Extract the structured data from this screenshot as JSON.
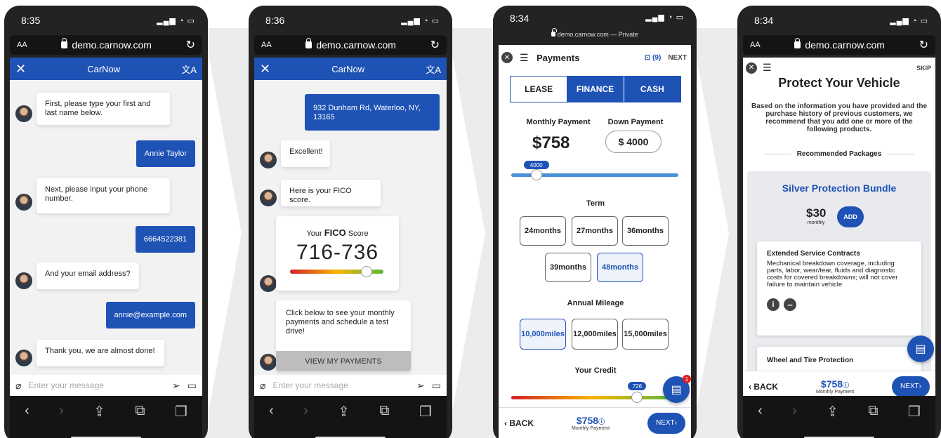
{
  "colors": {
    "brand": "#1f52b5",
    "background": "#ffffff",
    "chevron": "#ececec"
  },
  "phones": [
    {
      "time": "8:35",
      "url": "demo.carnow.com"
    },
    {
      "time": "8:36",
      "url": "demo.carnow.com"
    },
    {
      "time": "8:34",
      "url": "demo.carnow.com — Private"
    },
    {
      "time": "8:34",
      "url": "demo.carnow.com"
    }
  ],
  "browser": {
    "text_size_label": "AA"
  },
  "chat": {
    "app_title": "CarNow",
    "input_placeholder": "Enter your message",
    "screen1": {
      "bot1": "First, please type your first and last name below.",
      "user1": "Annie Taylor",
      "bot2": "Next, please input your phone number.",
      "user2": "6664522381",
      "bot3": "And your email address?",
      "user3": "annie@example.com",
      "bot4": "Thank you, we are almost done!"
    },
    "screen2": {
      "user_address": "932 Dunham Rd, Waterloo, NY, 13165",
      "bot1": "Excellent!",
      "bot2": "Here is your FICO score.",
      "fico_prefix": "Your",
      "fico_brand": "FICO",
      "fico_suffix": "Score",
      "fico_score": "716-736",
      "fico_position": 0.82,
      "cta_text": "Click below to see your monthly payments and schedule a test drive!",
      "cta_button": "VIEW MY PAYMENTS"
    }
  },
  "payments": {
    "title": "Payments",
    "saved_count": "(9)",
    "next_label": "NEXT",
    "tabs": [
      "LEASE",
      "FINANCE",
      "CASH"
    ],
    "monthly_label": "Monthly Payment",
    "monthly_value": "$758",
    "down_label": "Down Payment",
    "down_value": "$ 4000",
    "slider_value": "4000",
    "slider_fraction": 0.15,
    "term_label": "Term",
    "terms": [
      {
        "n": "24",
        "u": "months"
      },
      {
        "n": "27",
        "u": "months"
      },
      {
        "n": "36",
        "u": "months"
      },
      {
        "n": "39",
        "u": "months"
      },
      {
        "n": "48",
        "u": "months"
      }
    ],
    "mileage_label": "Annual Mileage",
    "mileages": [
      {
        "n": "10,000",
        "u": "miles"
      },
      {
        "n": "12,000",
        "u": "miles"
      },
      {
        "n": "15,000",
        "u": "miles"
      }
    ],
    "credit_label": "Your Credit",
    "credit_value": "726",
    "credit_fraction": 0.78,
    "chat_badge": "1",
    "back_label": "BACK",
    "footer_payment": "$758",
    "footer_payment_label": "Monthly Payment",
    "footer_next": "NEXT"
  },
  "protect": {
    "skip_label": "SKIP",
    "title": "Protect Your Vehicle",
    "description": "Based on the information you have provided and the purchase history of previous customers, we recommend that you add one or more of the following products.",
    "recommended_label": "Recommended Packages",
    "bundle_name": "Silver Protection Bundle",
    "bundle_price": "$30",
    "bundle_period": "monthly",
    "add_label": "ADD",
    "item1_title": "Extended Service Contracts",
    "item1_text": "Mechanical breakdown coverage, including parts, labor, wear/tear, fluids and diagnostic costs for covered breakdowns; will not cover failure to maintain vehicle",
    "item2_title": "Wheel and Tire Protection",
    "back_label": "BACK",
    "footer_payment": "$758",
    "footer_payment_label": "Monthly Payment",
    "footer_next": "NEXT"
  }
}
